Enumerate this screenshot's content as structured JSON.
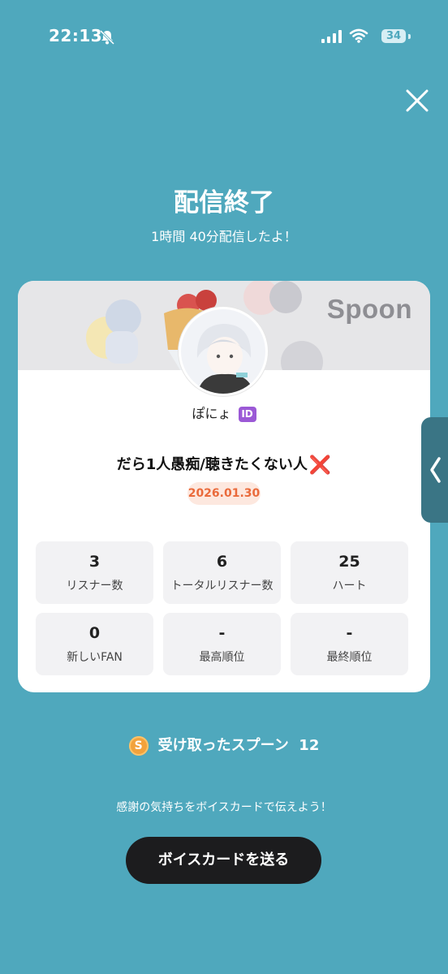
{
  "status_bar": {
    "time": "22:13",
    "battery": "34",
    "icons": [
      "bell-off-icon",
      "cellular-signal-icon",
      "wifi-icon",
      "battery-icon"
    ]
  },
  "header": {
    "close_icon": "close-icon"
  },
  "title": "配信終了",
  "subtitle": "1時間 40分配信したよ！",
  "card": {
    "brand": "Spoon",
    "nickname": "ぽにょ",
    "id_badge": "ID",
    "live_title": "だら1人愚痴/聴きたくない人",
    "live_title_emoji": "❌",
    "date": "2026.01.30",
    "stats": [
      {
        "value": "3",
        "label": "リスナー数"
      },
      {
        "value": "6",
        "label": "トータルリスナー数"
      },
      {
        "value": "25",
        "label": "ハート"
      },
      {
        "value": "0",
        "label": "新しいFAN"
      },
      {
        "value": "-",
        "label": "最高順位"
      },
      {
        "value": "-",
        "label": "最終順位"
      }
    ]
  },
  "side_tab": {
    "icon": "chevron-left-icon"
  },
  "spoons": {
    "coin_symbol": "S",
    "label": "受け取ったスプーン",
    "count": "12"
  },
  "thanks_text": "感謝の気持ちをボイスカードで伝えよう！",
  "send_button": "ボイスカードを送る",
  "colors": {
    "background": "#4fa8bd",
    "button": "#1c1c1e",
    "date_text": "#ea6a3b",
    "date_bg": "#fde8df",
    "id_badge": "#9b59d6"
  }
}
